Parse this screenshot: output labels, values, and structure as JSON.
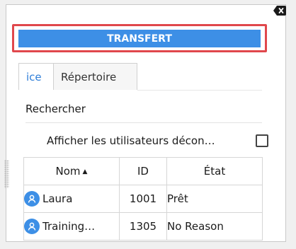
{
  "transfer_label": "TRANSFERT",
  "tabs": [
    {
      "label": "ice"
    },
    {
      "label": "Répertoire"
    }
  ],
  "search": {
    "label": "Rechercher"
  },
  "show_offline": {
    "label": "Afficher les utilisateurs décon…",
    "checked": false
  },
  "table": {
    "headers": {
      "name": "Nom",
      "sort_icon": "sort-ascending-icon",
      "id": "ID",
      "state": "État"
    },
    "rows": [
      {
        "avatar_icon": "user-avatar-icon",
        "name": "Laura",
        "id": "1001",
        "state": "Prêt"
      },
      {
        "avatar_icon": "user-avatar-icon",
        "name": "Training…",
        "id": "1305",
        "state": "No Reason"
      }
    ]
  },
  "colors": {
    "primary": "#3d8fe6",
    "highlight_border": "#e0474c",
    "active_tab": "#2f7ed8"
  }
}
